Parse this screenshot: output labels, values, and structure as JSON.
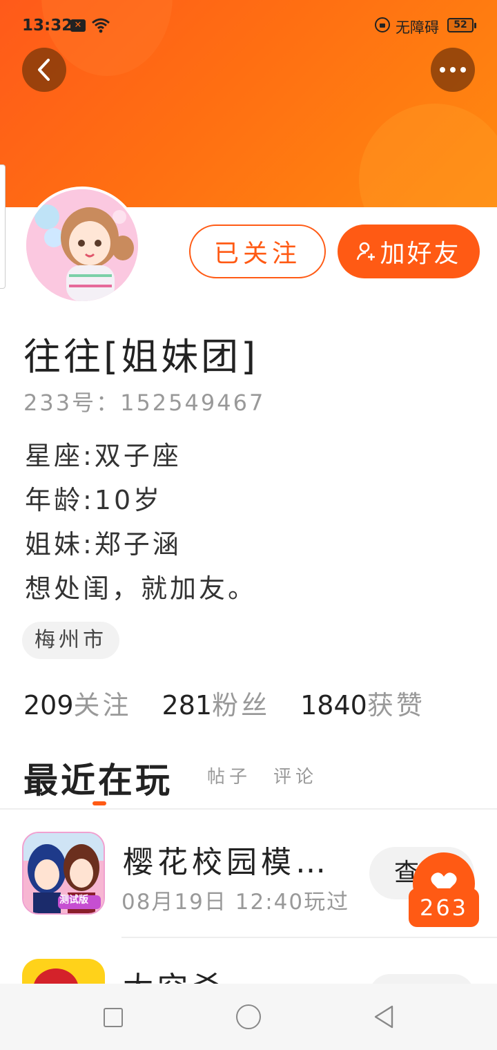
{
  "status_bar": {
    "time": "13:32",
    "notif_badge": "✕",
    "accessibility_label": "无障碍",
    "battery": "52"
  },
  "profile": {
    "follow_state_label": "已关注",
    "add_friend_label": "加好友",
    "name": "往往[姐妹团]",
    "id_line": "233号：152549467",
    "bio_lines": [
      "星座:双子座",
      "年龄:10岁",
      "姐妹:郑子涵",
      "想处闺，就加友。"
    ],
    "location": "梅州市",
    "stats": [
      {
        "value": "209",
        "label": "关注"
      },
      {
        "value": "281",
        "label": "粉丝"
      },
      {
        "value": "1840",
        "label": "获赞"
      }
    ]
  },
  "tabs": [
    {
      "label": "最近在玩",
      "active": true
    },
    {
      "label": "帖子",
      "active": false
    },
    {
      "label": "评论",
      "active": false
    }
  ],
  "games": [
    {
      "title": "樱花校园模…",
      "played": "08月19日 12:40玩过",
      "button": "查看",
      "icon_badge": "测试版"
    },
    {
      "title": "太空杀",
      "played": "",
      "button": ""
    }
  ],
  "like_float": {
    "count": "263"
  },
  "colors": {
    "accent": "#ff5a14",
    "banner_start": "#ff5a1a",
    "banner_end": "#ff8a10",
    "muted_text": "#999999"
  }
}
